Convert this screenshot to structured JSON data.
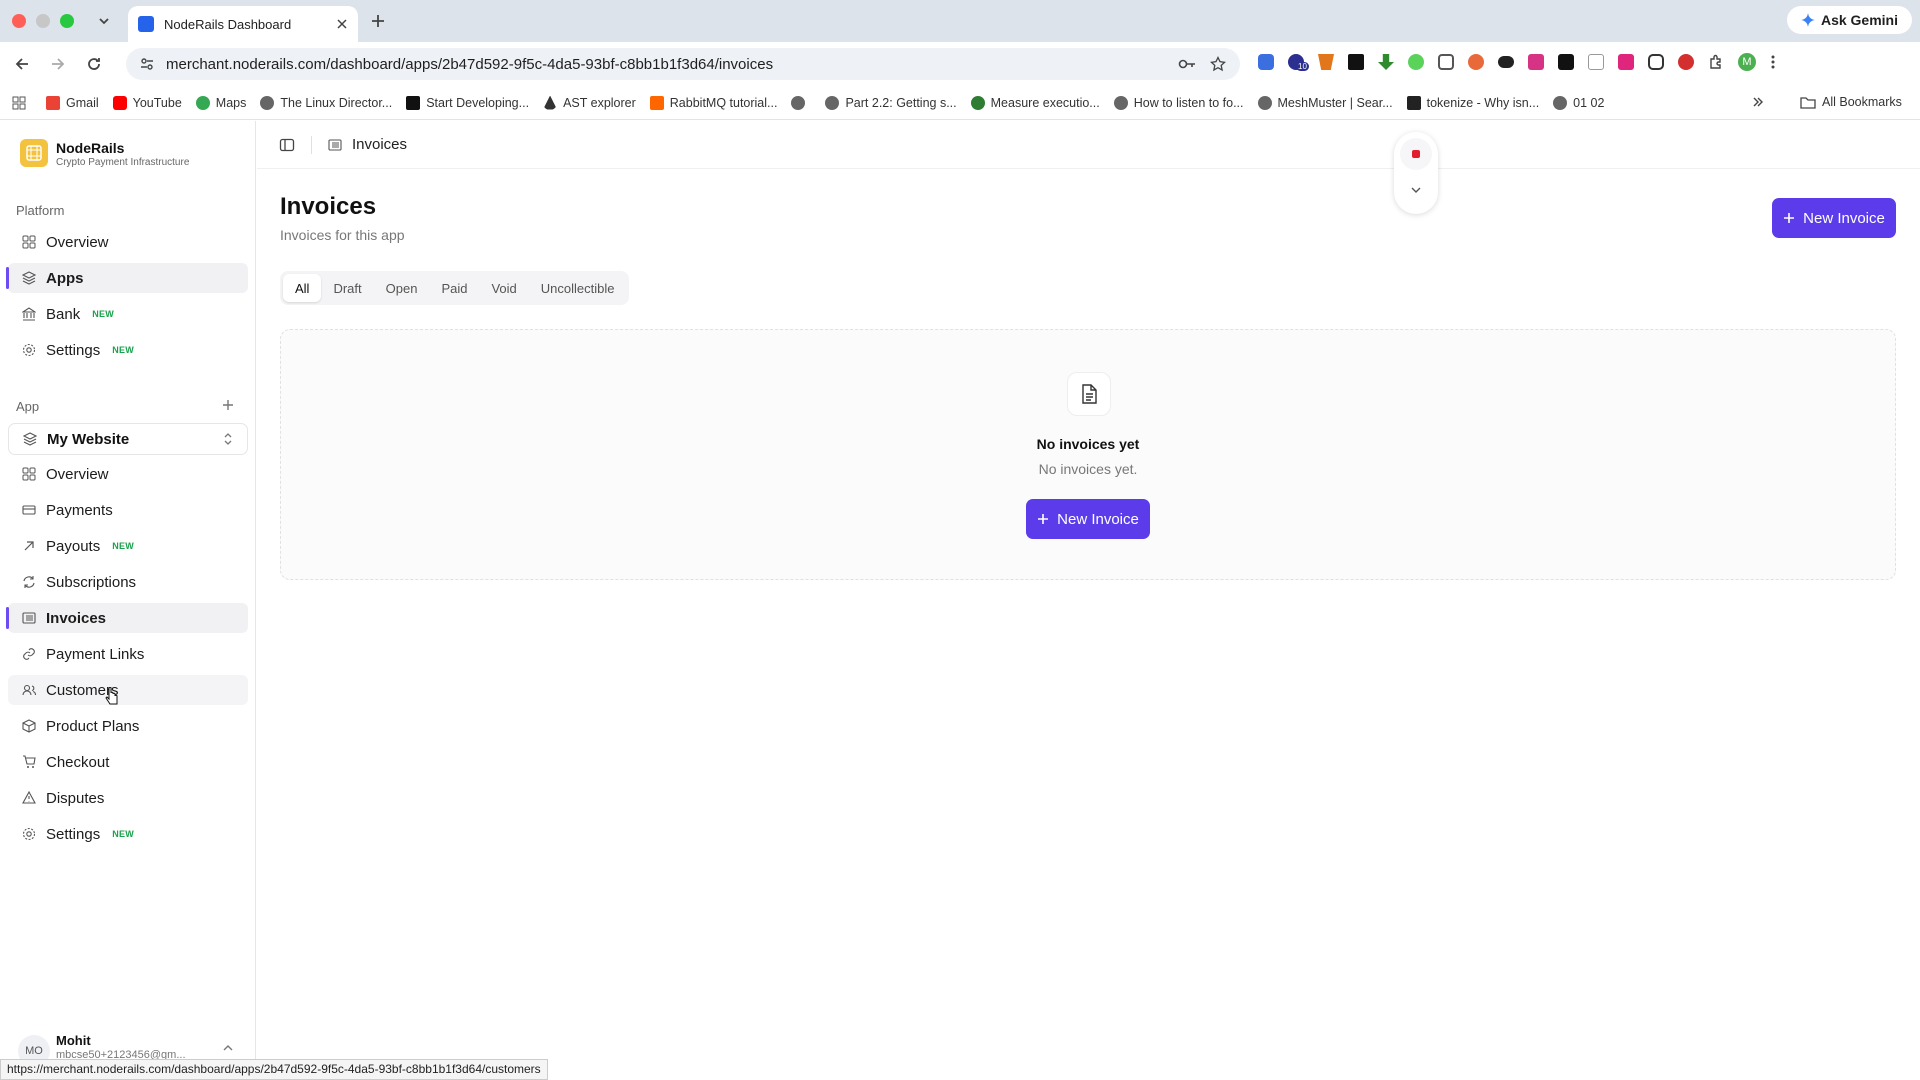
{
  "browser": {
    "tab_title": "NodeRails Dashboard",
    "url": "merchant.noderails.com/dashboard/apps/2b47d592-9f5c-4da5-93bf-c8bb1b1f3d64/invoices",
    "ask_gemini": "Ask Gemini",
    "bookmarks": [
      "Gmail",
      "YouTube",
      "Maps",
      "The Linux Director...",
      "Start Developing...",
      "AST explorer",
      "RabbitMQ tutorial...",
      "",
      "Part 2.2: Getting s...",
      "Measure executio...",
      "How to listen to fo...",
      "MeshMuster | Sear...",
      "tokenize - Why isn...",
      "01 02"
    ],
    "all_bookmarks": "All Bookmarks",
    "extension_badge": "10",
    "profile_initial": "M",
    "status_url": "https://merchant.noderails.com/dashboard/apps/2b47d592-9f5c-4da5-93bf-c8bb1b1f3d64/customers"
  },
  "brand": {
    "name": "NodeRails",
    "tagline": "Crypto Payment Infrastructure"
  },
  "sidebar": {
    "platform_label": "Platform",
    "platform_items": [
      {
        "label": "Overview",
        "icon": "grid-icon"
      },
      {
        "label": "Apps",
        "icon": "layers-icon"
      },
      {
        "label": "Bank",
        "icon": "bank-icon",
        "badge": "NEW"
      },
      {
        "label": "Settings",
        "icon": "gear-icon",
        "badge": "NEW"
      }
    ],
    "app_label": "App",
    "app_selector": "My Website",
    "app_items": [
      {
        "label": "Overview",
        "icon": "grid-icon"
      },
      {
        "label": "Payments",
        "icon": "card-icon"
      },
      {
        "label": "Payouts",
        "icon": "arrow-up-right-icon",
        "badge": "NEW"
      },
      {
        "label": "Subscriptions",
        "icon": "refresh-icon"
      },
      {
        "label": "Invoices",
        "icon": "list-icon"
      },
      {
        "label": "Payment Links",
        "icon": "link-icon"
      },
      {
        "label": "Customers",
        "icon": "users-icon"
      },
      {
        "label": "Product Plans",
        "icon": "box-icon"
      },
      {
        "label": "Checkout",
        "icon": "cart-icon"
      },
      {
        "label": "Disputes",
        "icon": "warning-icon"
      },
      {
        "label": "Settings",
        "icon": "gear-icon",
        "badge": "NEW"
      }
    ],
    "user": {
      "initials": "MO",
      "name": "Mohit",
      "email": "mbcse50+2123456@gm..."
    }
  },
  "main": {
    "breadcrumb": "Invoices",
    "title": "Invoices",
    "subtitle": "Invoices for this app",
    "new_invoice": "New Invoice",
    "filters": [
      "All",
      "Draft",
      "Open",
      "Paid",
      "Void",
      "Uncollectible"
    ],
    "empty_title": "No invoices yet",
    "empty_sub": "No invoices yet.",
    "empty_button": "New Invoice"
  },
  "colors": {
    "accent": "#5b3bea",
    "badge_green": "#17a34a"
  }
}
